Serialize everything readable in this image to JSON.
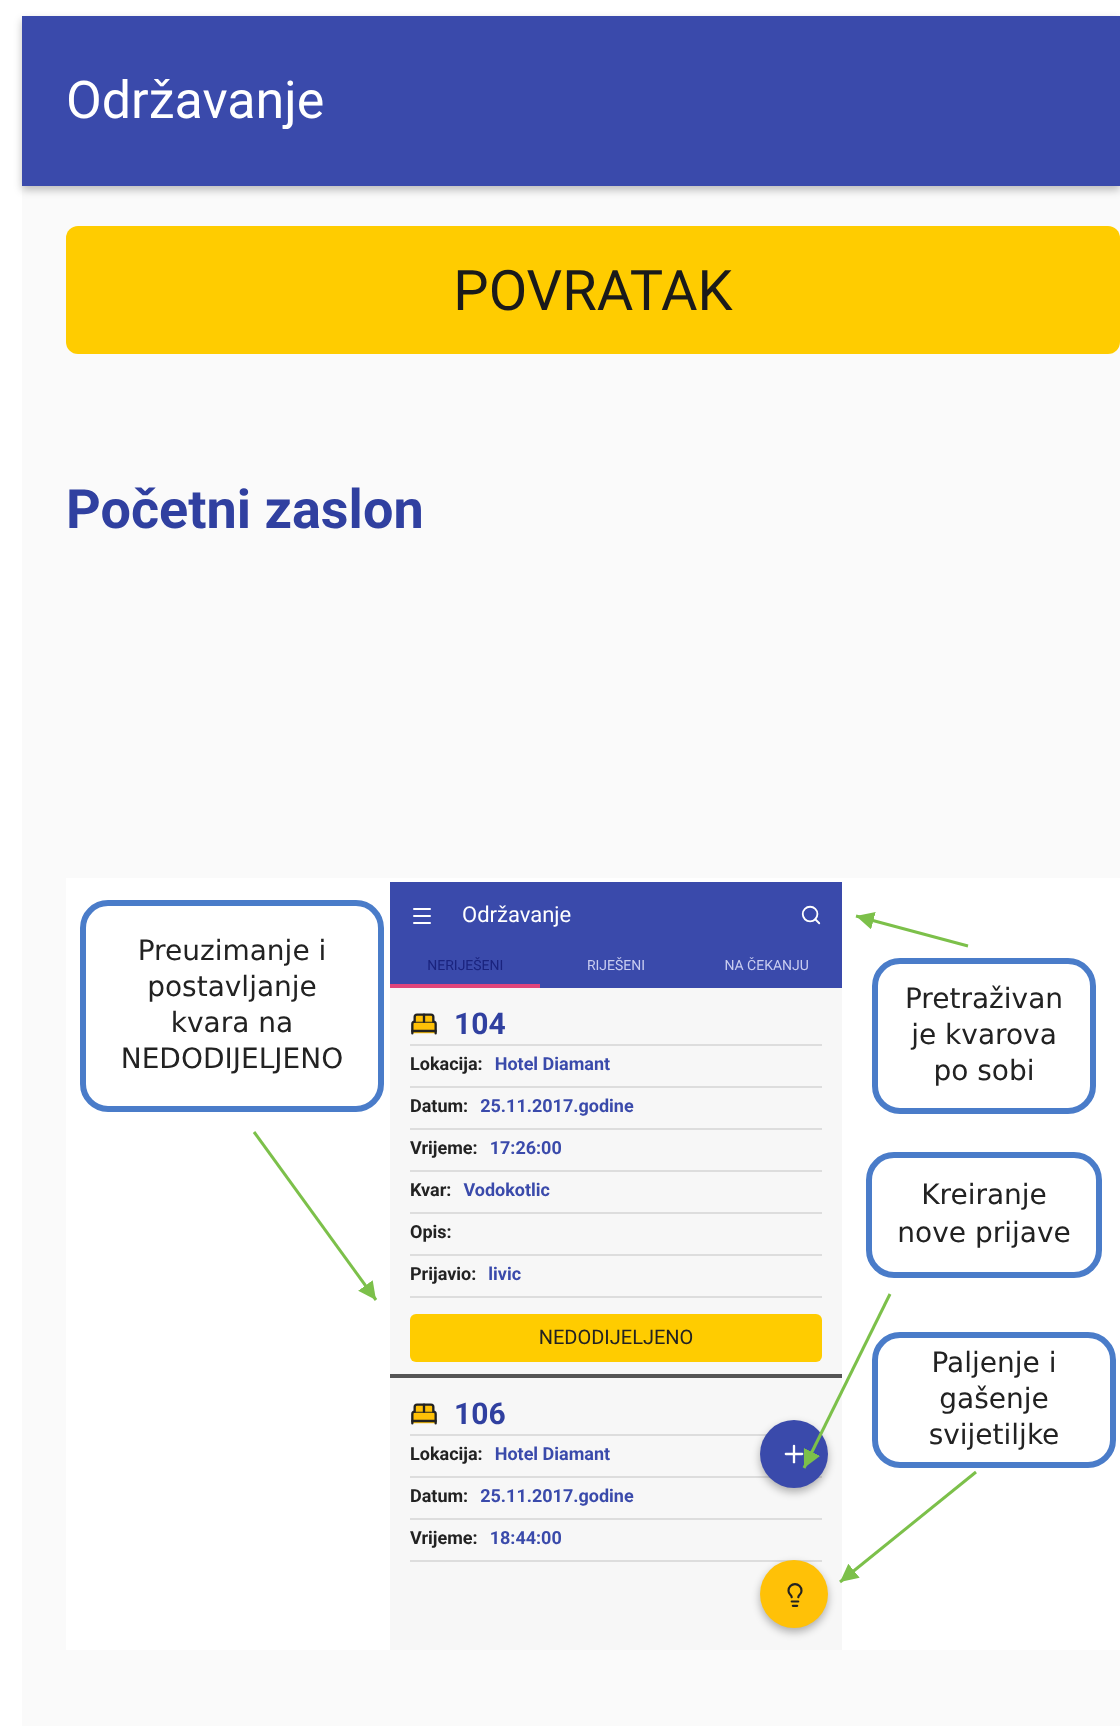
{
  "app_bar": {
    "title": "Održavanje"
  },
  "back_button": {
    "label": "POVRATAK"
  },
  "heading": "Početni zaslon",
  "figure": {
    "phone": {
      "title": "Održavanje",
      "tabs": [
        {
          "label": "NERIJEŠENI",
          "selected": true
        },
        {
          "label": "RIJEŠENI",
          "selected": false
        },
        {
          "label": "NA ČEKANJU",
          "selected": false
        }
      ],
      "cards": [
        {
          "room": "104",
          "fields": [
            {
              "label": "Lokacija:",
              "value": "Hotel Diamant"
            },
            {
              "label": "Datum:",
              "value": "25.11.2017.godine"
            },
            {
              "label": "Vrijeme:",
              "value": "17:26:00"
            },
            {
              "label": "Kvar:",
              "value": "Vodokotlic"
            },
            {
              "label": "Opis:"
            },
            {
              "label": "Prijavio:",
              "value": "livic"
            }
          ],
          "action": "NEDODIJELJENO"
        },
        {
          "room": "106",
          "fields": [
            {
              "label": "Lokacija:",
              "value": "Hotel Diamant"
            },
            {
              "label": "Datum:",
              "value": "25.11.2017.godine"
            },
            {
              "label": "Vrijeme:",
              "value": "18:44:00"
            }
          ]
        }
      ]
    },
    "callouts": [
      {
        "text": "Preuzimanje i postavljanje kvara na NEDODIJELJENO"
      },
      {
        "text": "Pretraživan je kvarova po sobi"
      },
      {
        "text": "Kreiranje nove prijave"
      },
      {
        "text": "Paljenje i gašenje svijetiljke"
      }
    ]
  }
}
